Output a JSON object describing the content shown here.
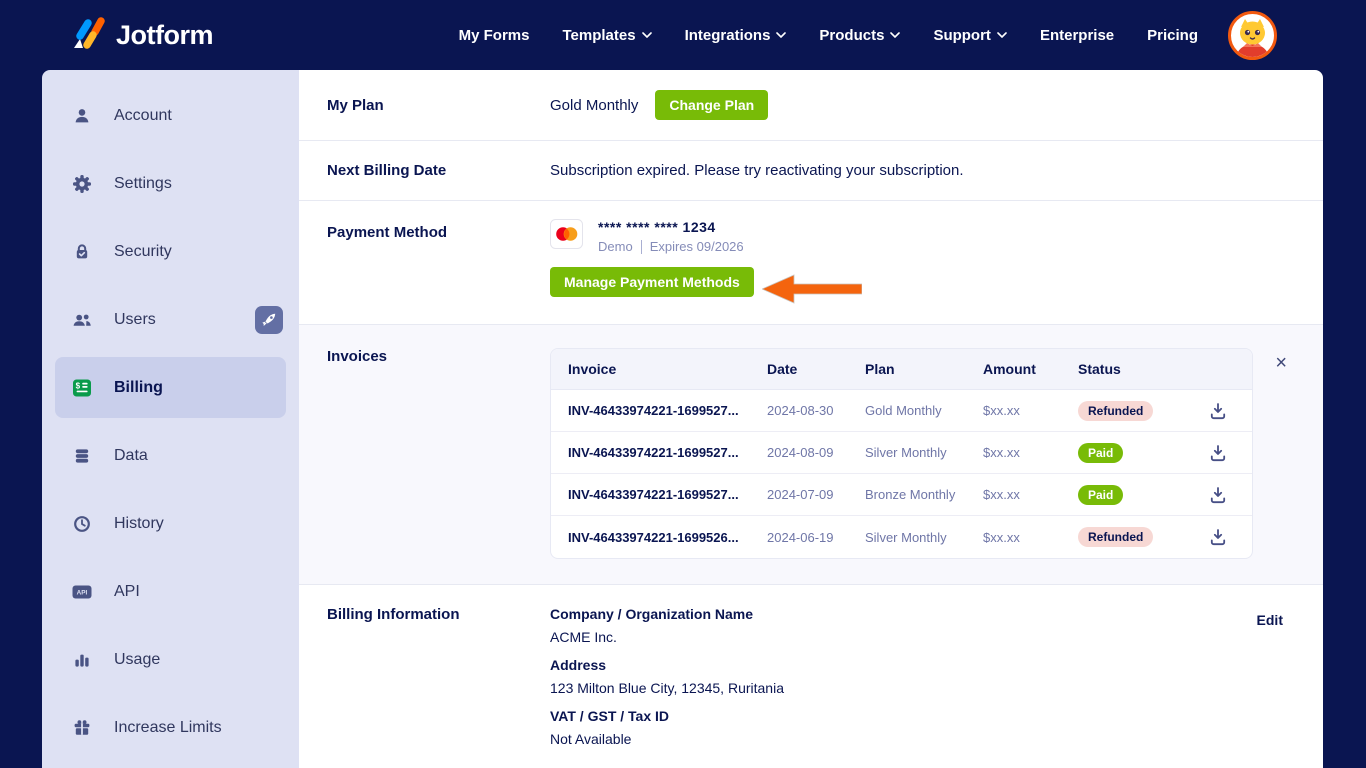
{
  "navbar": {
    "logo_text": "Jotform",
    "items": [
      {
        "label": "My Forms",
        "has_chevron": false
      },
      {
        "label": "Templates",
        "has_chevron": true
      },
      {
        "label": "Integrations",
        "has_chevron": true
      },
      {
        "label": "Products",
        "has_chevron": true
      },
      {
        "label": "Support",
        "has_chevron": true
      },
      {
        "label": "Enterprise",
        "has_chevron": false
      },
      {
        "label": "Pricing",
        "has_chevron": false
      }
    ]
  },
  "sidebar": {
    "items": [
      {
        "label": "Account",
        "icon": "user-icon",
        "active": false
      },
      {
        "label": "Settings",
        "icon": "gear-icon",
        "active": false
      },
      {
        "label": "Security",
        "icon": "lock-icon",
        "active": false
      },
      {
        "label": "Users",
        "icon": "users-icon",
        "active": false,
        "badge": "rocket-icon"
      },
      {
        "label": "Billing",
        "icon": "invoice-dollar-icon",
        "active": true
      },
      {
        "label": "Data",
        "icon": "database-icon",
        "active": false
      },
      {
        "label": "History",
        "icon": "clock-icon",
        "active": false
      },
      {
        "label": "API",
        "icon": "api-icon",
        "active": false
      },
      {
        "label": "Usage",
        "icon": "bar-chart-icon",
        "active": false
      },
      {
        "label": "Increase Limits",
        "icon": "gift-icon",
        "active": false
      }
    ]
  },
  "main": {
    "my_plan": {
      "label": "My Plan",
      "value": "Gold Monthly",
      "button": "Change Plan"
    },
    "next_billing": {
      "label": "Next Billing Date",
      "value": "Subscription expired. Please try reactivating your subscription."
    },
    "payment_method": {
      "label": "Payment Method",
      "card_brand": "mastercard",
      "card_number": "**** **** **** 1234",
      "card_holder": "Demo",
      "expires": "Expires 09/2026",
      "button": "Manage Payment Methods"
    },
    "invoices": {
      "label": "Invoices",
      "columns": [
        "Invoice",
        "Date",
        "Plan",
        "Amount",
        "Status"
      ],
      "rows": [
        {
          "invoice": "INV-46433974221-1699527...",
          "date": "2024-08-30",
          "plan": "Gold Monthly",
          "amount": "$xx.xx",
          "status": "Refunded"
        },
        {
          "invoice": "INV-46433974221-1699527...",
          "date": "2024-08-09",
          "plan": "Silver Monthly",
          "amount": "$xx.xx",
          "status": "Paid"
        },
        {
          "invoice": "INV-46433974221-1699527...",
          "date": "2024-07-09",
          "plan": "Bronze Monthly",
          "amount": "$xx.xx",
          "status": "Paid"
        },
        {
          "invoice": "INV-46433974221-1699526...",
          "date": "2024-06-19",
          "plan": "Silver Monthly",
          "amount": "$xx.xx",
          "status": "Refunded"
        }
      ],
      "close_label": "×"
    },
    "billing_info": {
      "label": "Billing Information",
      "fields": [
        {
          "name": "Company / Organization Name",
          "value": "ACME Inc."
        },
        {
          "name": "Address",
          "value": "123 Milton Blue City, 12345, Ruritania"
        },
        {
          "name": "VAT / GST / Tax ID",
          "value": "Not Available"
        }
      ],
      "edit_label": "Edit"
    }
  },
  "colors": {
    "navy": "#0a1551",
    "sidebar_bg": "#dee1f3",
    "sidebar_active_bg": "#c9cfeb",
    "button_green": "#78bb07",
    "annotation_orange": "#f4640e",
    "badge_refunded_bg": "#f7d8d4",
    "badge_paid_bg": "#78bb07",
    "invoices_section_bg": "#f8f8fd",
    "mastercard_red": "#eb001b",
    "mastercard_orange": "#f79e1b"
  }
}
